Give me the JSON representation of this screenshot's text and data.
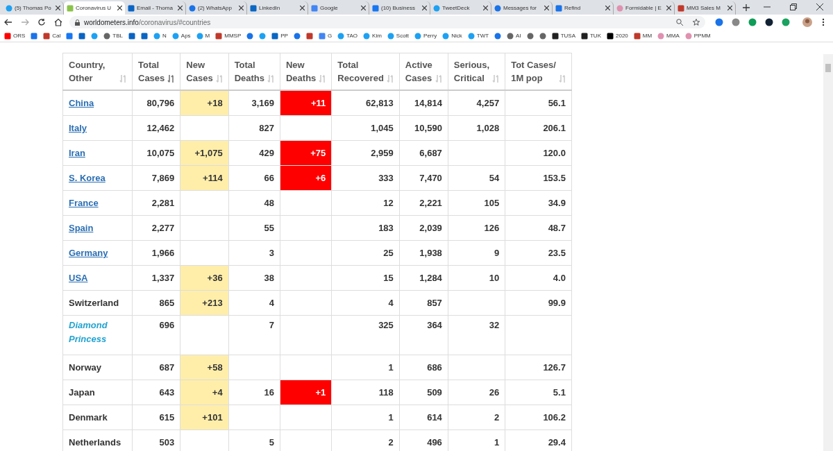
{
  "tabs": [
    {
      "title": "(5) Thomas Po",
      "selected": false
    },
    {
      "title": "Coronavirus U",
      "selected": true
    },
    {
      "title": "Email - Thoma",
      "selected": false
    },
    {
      "title": "(2) WhatsApp",
      "selected": false
    },
    {
      "title": "LinkedIn",
      "selected": false
    },
    {
      "title": "Google",
      "selected": false
    },
    {
      "title": "(10) Business",
      "selected": false
    },
    {
      "title": "TweetDeck",
      "selected": false
    },
    {
      "title": "Messages for",
      "selected": false
    },
    {
      "title": "Refind",
      "selected": false
    },
    {
      "title": "Formidable | E",
      "selected": false
    },
    {
      "title": "MM3 Sales M",
      "selected": false
    }
  ],
  "address": {
    "host": "worldometers.info",
    "path": "/coronavirus/#countries"
  },
  "bookmarks": [
    "ORS",
    "Cal",
    "TBL",
    "N",
    "Aps",
    "M",
    "MMSP",
    "PP",
    "G",
    "TAO",
    "Kim",
    "Scott",
    "Perry",
    "Nick",
    "TWT",
    "AI",
    "TUSA",
    "TUK",
    "2020",
    "MM",
    "MMA",
    "PPMM"
  ],
  "table": {
    "columns": [
      {
        "label": "Country,",
        "label2": "Other",
        "sorted": false
      },
      {
        "label": "Total",
        "label2": "Cases",
        "sorted": true
      },
      {
        "label": "New",
        "label2": "Cases",
        "sorted": false
      },
      {
        "label": "Total",
        "label2": "Deaths",
        "sorted": false
      },
      {
        "label": "New",
        "label2": "Deaths",
        "sorted": false
      },
      {
        "label": "Total",
        "label2": "Recovered",
        "sorted": false
      },
      {
        "label": "Active",
        "label2": "Cases",
        "sorted": false
      },
      {
        "label": "Serious,",
        "label2": "Critical",
        "sorted": false
      },
      {
        "label": "Tot Cases/",
        "label2": "1M pop",
        "sorted": false
      }
    ],
    "rows": [
      {
        "kind": "link",
        "cells": [
          "China",
          "80,796",
          "+18",
          "3,169",
          "+11",
          "62,813",
          "14,814",
          "4,257",
          "56.1"
        ]
      },
      {
        "kind": "link",
        "cells": [
          "Italy",
          "12,462",
          "",
          "827",
          "",
          "1,045",
          "10,590",
          "1,028",
          "206.1"
        ]
      },
      {
        "kind": "link",
        "cells": [
          "Iran",
          "10,075",
          "+1,075",
          "429",
          "+75",
          "2,959",
          "6,687",
          "",
          "120.0"
        ]
      },
      {
        "kind": "link",
        "cells": [
          "S. Korea",
          "7,869",
          "+114",
          "66",
          "+6",
          "333",
          "7,470",
          "54",
          "153.5"
        ]
      },
      {
        "kind": "link",
        "cells": [
          "France",
          "2,281",
          "",
          "48",
          "",
          "12",
          "2,221",
          "105",
          "34.9"
        ]
      },
      {
        "kind": "link",
        "cells": [
          "Spain",
          "2,277",
          "",
          "55",
          "",
          "183",
          "2,039",
          "126",
          "48.7"
        ]
      },
      {
        "kind": "link",
        "cells": [
          "Germany",
          "1,966",
          "",
          "3",
          "",
          "25",
          "1,938",
          "9",
          "23.5"
        ]
      },
      {
        "kind": "link",
        "cells": [
          "USA",
          "1,337",
          "+36",
          "38",
          "",
          "15",
          "1,284",
          "10",
          "4.0"
        ]
      },
      {
        "kind": "plain",
        "cells": [
          "Switzerland",
          "865",
          "+213",
          "4",
          "",
          "4",
          "857",
          "",
          "99.9"
        ]
      },
      {
        "kind": "ship",
        "cells": [
          "Diamond Princess",
          "696",
          "",
          "7",
          "",
          "325",
          "364",
          "32",
          ""
        ]
      },
      {
        "kind": "plain",
        "cells": [
          "Norway",
          "687",
          "+58",
          "",
          "",
          "1",
          "686",
          "",
          "126.7"
        ]
      },
      {
        "kind": "plain",
        "cells": [
          "Japan",
          "643",
          "+4",
          "16",
          "+1",
          "118",
          "509",
          "26",
          "5.1"
        ]
      },
      {
        "kind": "plain",
        "cells": [
          "Denmark",
          "615",
          "+101",
          "",
          "",
          "1",
          "614",
          "2",
          "106.2"
        ]
      },
      {
        "kind": "plain",
        "cells": [
          "Netherlands",
          "503",
          "",
          "5",
          "",
          "2",
          "496",
          "1",
          "29.4"
        ]
      }
    ]
  }
}
